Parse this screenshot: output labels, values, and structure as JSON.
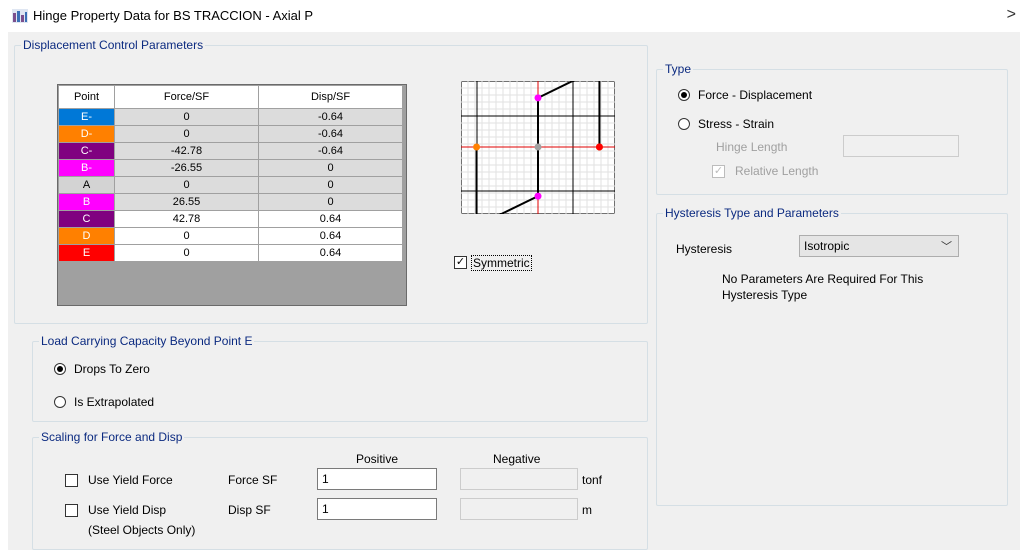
{
  "window": {
    "title": "Hinge Property Data for BS TRACCION - Axial P",
    "close_glyph": ">"
  },
  "displacement": {
    "legend": "Displacement Control Parameters",
    "columns": [
      "Point",
      "Force/SF",
      "Disp/SF"
    ],
    "rows": [
      {
        "point": "E-",
        "force": "0",
        "disp": "-0.64",
        "color": "#0078d7"
      },
      {
        "point": "D-",
        "force": "0",
        "disp": "-0.64",
        "color": "#ff8000"
      },
      {
        "point": "C-",
        "force": "-42.78",
        "disp": "-0.64",
        "color": "#800080"
      },
      {
        "point": "B-",
        "force": "-26.55",
        "disp": "0",
        "color": "#ff00ff"
      },
      {
        "point": "A",
        "force": "0",
        "disp": "0",
        "color": "#d3d3d3"
      },
      {
        "point": "B",
        "force": "26.55",
        "disp": "0",
        "color": "#ff00ff"
      },
      {
        "point": "C",
        "force": "42.78",
        "disp": "0.64",
        "color": "#800080"
      },
      {
        "point": "D",
        "force": "0",
        "disp": "0.64",
        "color": "#ff8000"
      },
      {
        "point": "E",
        "force": "0",
        "disp": "0.64",
        "color": "#ff0000"
      }
    ],
    "symmetric_label": "Symmetric",
    "symmetric_checked": true
  },
  "type": {
    "legend": "Type",
    "force_displacement": "Force - Displacement",
    "stress_strain": "Stress - Strain",
    "selected": "Force - Displacement",
    "hinge_length_label": "Hinge Length",
    "hinge_length_value": "",
    "relative_length_label": "Relative Length",
    "relative_length_checked": true
  },
  "hysteresis": {
    "legend": "Hysteresis Type and Parameters",
    "label": "Hysteresis",
    "value": "Isotropic",
    "message_line1": "No Parameters Are Required For This",
    "message_line2": "Hysteresis Type"
  },
  "load_capacity": {
    "legend": "Load Carrying Capacity Beyond Point E",
    "drops_to_zero": "Drops To Zero",
    "is_extrapolated": "Is Extrapolated",
    "selected": "Drops To Zero"
  },
  "scaling": {
    "legend": "Scaling for Force and Disp",
    "positive_header": "Positive",
    "negative_header": "Negative",
    "use_yield_force": "Use Yield Force",
    "use_yield_disp": "Use Yield Disp",
    "steel_note": "(Steel Objects Only)",
    "force_sf_label": "Force SF",
    "disp_sf_label": "Disp SF",
    "force_positive": "1",
    "force_negative": "",
    "disp_positive": "1",
    "disp_negative": "",
    "force_unit": "tonf",
    "disp_unit": "m"
  }
}
